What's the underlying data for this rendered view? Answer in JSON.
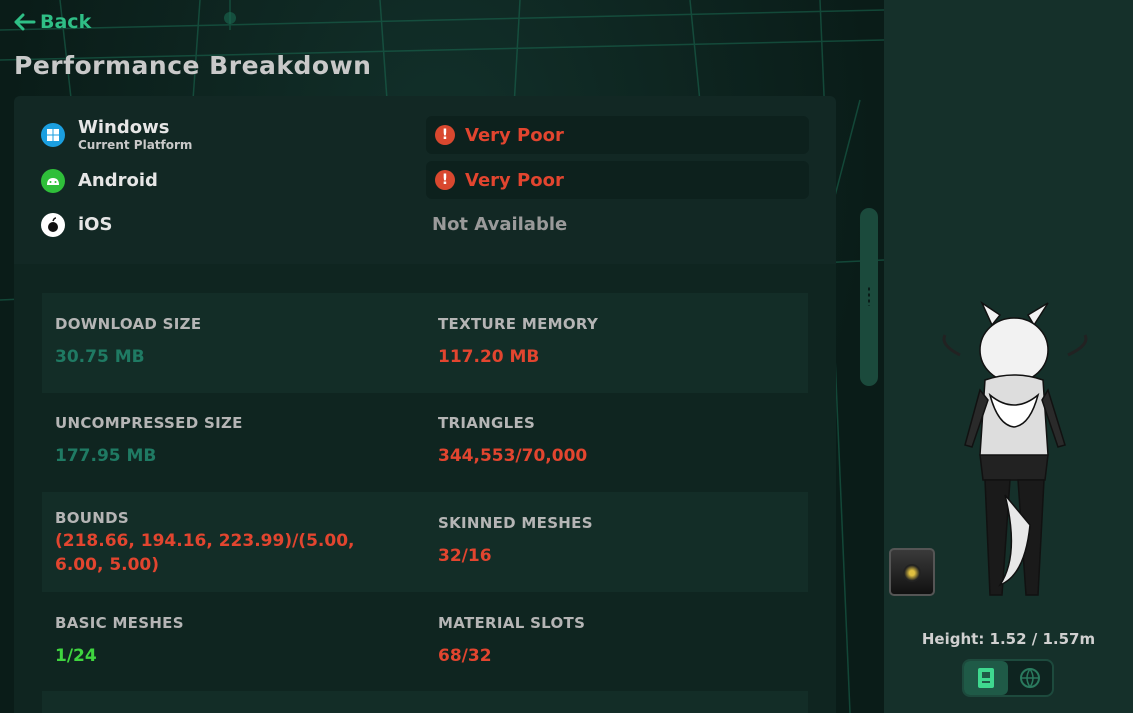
{
  "nav": {
    "back_label": "Back"
  },
  "page": {
    "title": "Performance Breakdown"
  },
  "platforms": [
    {
      "name": "Windows",
      "subtitle": "Current Platform",
      "icon": "windows-icon",
      "rating": "Very Poor"
    },
    {
      "name": "Android",
      "subtitle": "",
      "icon": "android-icon",
      "rating": "Very Poor"
    },
    {
      "name": "iOS",
      "subtitle": "",
      "icon": "apple-icon",
      "rating": "Not Available"
    }
  ],
  "stats": {
    "download_size": {
      "label": "DOWNLOAD SIZE",
      "value": "30.75 MB"
    },
    "texture_memory": {
      "label": "TEXTURE MEMORY",
      "value": "117.20 MB"
    },
    "uncompressed_size": {
      "label": "UNCOMPRESSED SIZE",
      "value": "177.95 MB"
    },
    "triangles": {
      "label": "TRIANGLES",
      "value": "344,553/70,000"
    },
    "bounds": {
      "label": "BOUNDS",
      "value": "(218.66, 194.16, 223.99)/(5.00, 6.00, 5.00)"
    },
    "skinned_meshes": {
      "label": "SKINNED MESHES",
      "value": "32/16"
    },
    "basic_meshes": {
      "label": "BASIC MESHES",
      "value": "1/24"
    },
    "material_slots": {
      "label": "MATERIAL SLOTS",
      "value": "68/32"
    }
  },
  "preview": {
    "height_text": "Height: 1.52 / 1.57m"
  },
  "colors": {
    "accent": "#2fbf86",
    "very_poor": "#e2452f",
    "good": "#3fd43f",
    "neutral_value": "#1f7a63"
  }
}
